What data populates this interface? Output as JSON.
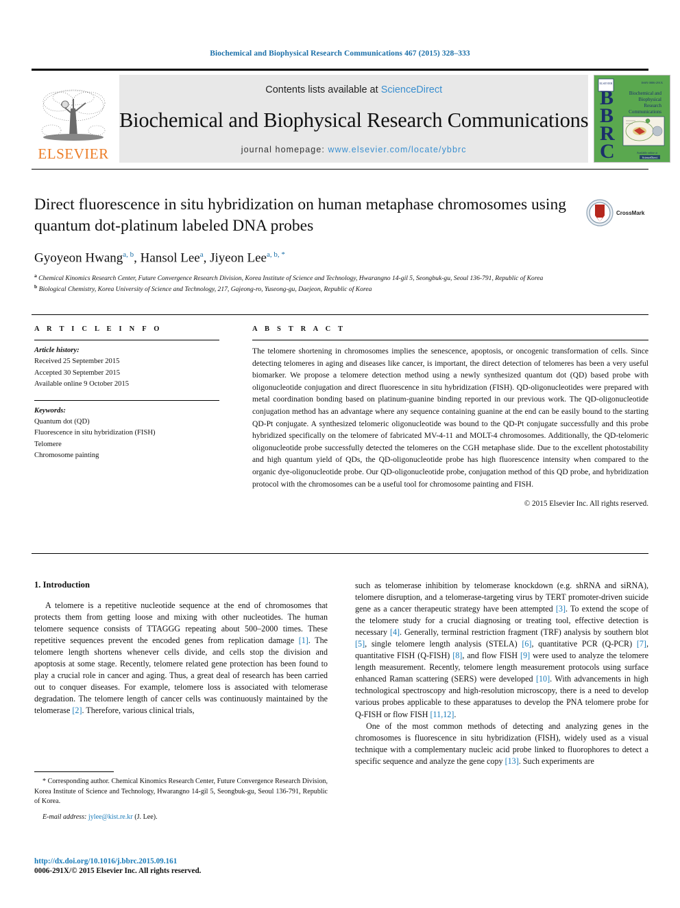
{
  "running_head": "Biochemical and Biophysical Research Communications 467 (2015) 328–333",
  "masthead": {
    "contents_prefix": "Contents lists available at ",
    "sciencedirect": "ScienceDirect",
    "journal_title": "Biochemical and Biophysical Research Communications",
    "homepage_label": "journal homepage: ",
    "homepage_url": "www.elsevier.com/locate/ybbrc",
    "publisher_wordmark": "ELSEVIER",
    "publisher_color": "#ec7c26",
    "cover": {
      "letters": "BBRC",
      "title_lines": [
        "Biochemical and",
        "Biophysical",
        "Research",
        "Communications"
      ],
      "background_color": "#5aa84f",
      "letter_color": "#1b2f6b"
    }
  },
  "article": {
    "title": "Direct fluorescence in situ hybridization on human metaphase chromosomes using quantum dot-platinum labeled DNA probes",
    "authors": [
      {
        "name": "Gyoyeon Hwang",
        "marks": "a, b"
      },
      {
        "name": "Hansol Lee",
        "marks": "a"
      },
      {
        "name": "Jiyeon Lee",
        "marks": "a, b, *"
      }
    ],
    "affiliations": [
      {
        "mark": "a",
        "text": "Chemical Kinomics Research Center, Future Convergence Research Division, Korea Institute of Science and Technology, Hwarangno 14-gil 5, Seongbuk-gu, Seoul 136-791, Republic of Korea"
      },
      {
        "mark": "b",
        "text": "Biological Chemistry, Korea University of Science and Technology, 217, Gajeong-ro, Yuseong-gu, Daejeon, Republic of Korea"
      }
    ],
    "crossmark_label": "CrossMark"
  },
  "article_info": {
    "heading": "A R T I C L E   I N F O",
    "history_label": "Article history:",
    "history": [
      "Received 25 September 2015",
      "Accepted 30 September 2015",
      "Available online 9 October 2015"
    ],
    "keywords_label": "Keywords:",
    "keywords": [
      "Quantum dot (QD)",
      "Fluorescence in situ hybridization (FISH)",
      "Telomere",
      "Chromosome painting"
    ]
  },
  "abstract": {
    "heading": "A B S T R A C T",
    "text": "The telomere shortening in chromosomes implies the senescence, apoptosis, or oncogenic transformation of cells. Since detecting telomeres in aging and diseases like cancer, is important, the direct detection of telomeres has been a very useful biomarker. We propose a telomere detection method using a newly synthesized quantum dot (QD) based probe with oligonucleotide conjugation and direct fluorescence in situ hybridization (FISH). QD-oligonucleotides were prepared with metal coordination bonding based on platinum-guanine binding reported in our previous work. The QD-oligonucleotide conjugation method has an advantage where any sequence containing guanine at the end can be easily bound to the starting QD-Pt conjugate. A synthesized telomeric oligonucleotide was bound to the QD-Pt conjugate successfully and this probe hybridized specifically on the telomere of fabricated MV-4-11 and MOLT-4 chromosomes. Additionally, the QD-telomeric oligonucleotide probe successfully detected the telomeres on the CGH metaphase slide. Due to the excellent photostability and high quantum yield of QDs, the QD-oligonucleotide probe has high fluorescence intensity when compared to the organic dye-oligonucleotide probe. Our QD-oligonucleotide probe, conjugation method of this QD probe, and hybridization protocol with the chromosomes can be a useful tool for chromosome painting and FISH.",
    "copyright": "© 2015 Elsevier Inc. All rights reserved."
  },
  "body": {
    "section_heading": "1. Introduction",
    "left_paragraphs": [
      "A telomere is a repetitive nucleotide sequence at the end of chromosomes that protects them from getting loose and mixing with other nucleotides. The human telomere sequence consists of TTAGGG repeating about 500–2000 times. These repetitive sequences prevent the encoded genes from replication damage [1]. The telomere length shortens whenever cells divide, and cells stop the division and apoptosis at some stage. Recently, telomere related gene protection has been found to play a crucial role in cancer and aging. Thus, a great deal of research has been carried out to conquer diseases. For example, telomere loss is associated with telomerase degradation. The telomere length of cancer cells was continuously maintained by the telomerase [2]. Therefore, various clinical trials,"
    ],
    "right_paragraphs": [
      "such as telomerase inhibition by telomerase knockdown (e.g. shRNA and siRNA), telomere disruption, and a telomerase-targeting virus by TERT promoter-driven suicide gene as a cancer therapeutic strategy have been attempted [3]. To extend the scope of the telomere study for a crucial diagnosing or treating tool, effective detection is necessary [4]. Generally, terminal restriction fragment (TRF) analysis by southern blot [5], single telomere length analysis (STELA) [6], quantitative PCR (Q-PCR) [7], quantitative FISH (Q-FISH) [8], and flow FISH [9] were used to analyze the telomere length measurement. Recently, telomere length measurement protocols using surface enhanced Raman scattering (SERS) were developed [10]. With advancements in high technological spectroscopy and high-resolution microscopy, there is a need to develop various probes applicable to these apparatuses to develop the PNA telomere probe for Q-FISH or flow FISH [11,12].",
      "One of the most common methods of detecting and analyzing genes in the chromosomes is fluorescence in situ hybridization (FISH), widely used as a visual technique with a complementary nucleic acid probe linked to fluorophores to detect a specific sequence and analyze the gene copy [13]. Such experiments are"
    ]
  },
  "footnote": {
    "text": "* Corresponding author. Chemical Kinomics Research Center, Future Convergence Research Division, Korea Institute of Science and Technology, Hwarangno 14-gil 5, Seongbuk-gu, Seoul 136-791, Republic of Korea.",
    "email_label": "E-mail address: ",
    "email": "jylee@kist.re.kr",
    "email_suffix": " (J. Lee)."
  },
  "footer": {
    "doi": "http://dx.doi.org/10.1016/j.bbrc.2015.09.161",
    "issn_line": "0006-291X/© 2015 Elsevier Inc. All rights reserved."
  },
  "colors": {
    "link_blue": "#1a7bb9",
    "header_blue": "#1a6fa8",
    "sciencedirect_blue": "#3a8fd0",
    "elsevier_orange": "#ec7c26"
  }
}
